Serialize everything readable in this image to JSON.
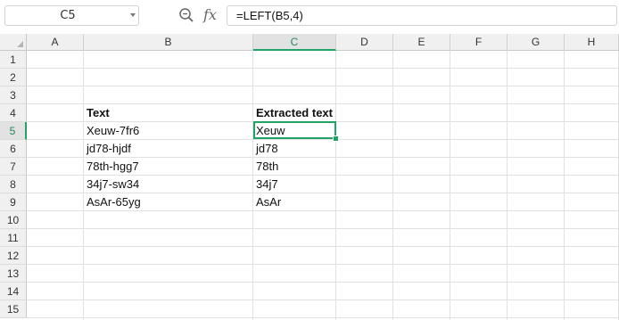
{
  "name_box": {
    "value": "C5"
  },
  "formula_bar": {
    "formula": "=LEFT(B5,4)",
    "zoom_icon": "zoom-icon",
    "fx_label": "fx"
  },
  "columns": [
    "A",
    "B",
    "C",
    "D",
    "E",
    "F",
    "G",
    "H"
  ],
  "rows": [
    "1",
    "2",
    "3",
    "4",
    "5",
    "6",
    "7",
    "8",
    "9",
    "10",
    "11",
    "12",
    "13",
    "14",
    "15"
  ],
  "active_cell": {
    "column": "C",
    "row": "5"
  },
  "cells": {
    "B4": "Text",
    "C4": "Extracted text",
    "B5": "Xeuw-7fr6",
    "C5": "Xeuw",
    "B6": "jd78-hjdf",
    "C6": "jd78",
    "B7": "78th-hgg7",
    "C7": "78th",
    "B8": "34j7-sw34",
    "C8": "34j7",
    "B9": "AsAr-65yg",
    "C9": "AsAr"
  },
  "colors": {
    "accent": "#21a366",
    "header_bg": "#f0f0f0",
    "gridline": "#e1e1e1"
  }
}
